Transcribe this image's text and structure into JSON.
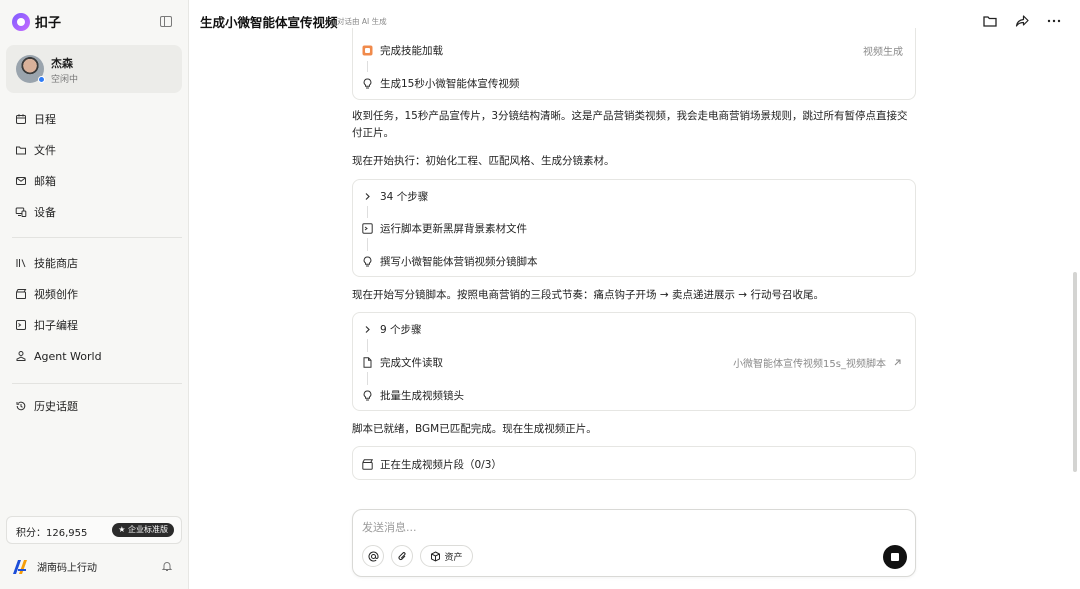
{
  "app": {
    "name": "扣子"
  },
  "user": {
    "name": "杰森",
    "status": "空闲中"
  },
  "sidebar": {
    "items": [
      {
        "label": "日程"
      },
      {
        "label": "文件"
      },
      {
        "label": "邮箱"
      },
      {
        "label": "设备"
      },
      {
        "label": "技能商店"
      },
      {
        "label": "视频创作"
      },
      {
        "label": "扣子编程"
      },
      {
        "label": "Agent World"
      },
      {
        "label": "历史话题"
      }
    ],
    "points": "积分：126,955",
    "badge": "企业标准版",
    "workspace": "湖南码上行动"
  },
  "header": {
    "title": "生成小微智能体宣传视频",
    "subtitle": "对话由 AI 生成"
  },
  "chat": {
    "card1": {
      "row1": {
        "label": "完成技能加载",
        "tag": "视频生成"
      },
      "row2": {
        "label": "生成15秒小微智能体宣传视频"
      }
    },
    "para1": "收到任务，15秒产品宣传片，3分镜结构清晰。这是产品营销类视频，我会走电商营销场景规则，跳过所有暂停点直接交付正片。",
    "para2": "现在开始执行：初始化工程、匹配风格、生成分镜素材。",
    "card2": {
      "steps": "34 个步骤",
      "row1": "运行脚本更新黑屏背景素材文件",
      "row2": "撰写小微智能体营销视频分镜脚本"
    },
    "para3": "现在开始写分镜脚本。按照电商营销的三段式节奏：痛点钩子开场 → 卖点递进展示 → 行动号召收尾。",
    "card3": {
      "steps": "9 个步骤",
      "row1": {
        "label": "完成文件读取",
        "file": "小微智能体宣传视频15s_视频脚本"
      },
      "row2": "批量生成视频镜头"
    },
    "para4": "脚本已就绪，BGM已匹配完成。现在生成视频正片。",
    "card4": {
      "label": "正在生成视频片段（0/3）"
    }
  },
  "composer": {
    "placeholder": "发送消息...",
    "assets_label": "资产"
  },
  "colors": {
    "accent": "#7c5cff",
    "online": "#2f7cf6",
    "stop": "#111111",
    "skill_icon": "#f08a4b"
  }
}
